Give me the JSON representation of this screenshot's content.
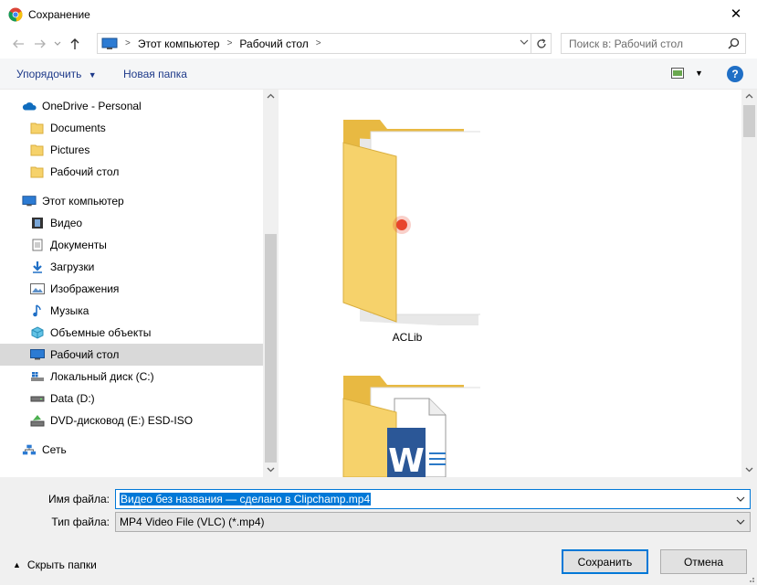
{
  "window": {
    "title": "Сохранение",
    "close_glyph": "✕",
    "app_icon": "chrome-icon"
  },
  "address_bar": {
    "crumbs": [
      "Этот компьютер",
      "Рабочий стол"
    ],
    "separator": ">"
  },
  "search": {
    "placeholder": "Поиск в: Рабочий стол"
  },
  "toolbar": {
    "organize_label": "Упорядочить",
    "new_folder_label": "Новая папка",
    "help_label": "?"
  },
  "nav_tree": {
    "onedrive": "OneDrive - Personal",
    "onedrive_children": [
      "Documents",
      "Pictures",
      "Рабочий стол"
    ],
    "this_pc": "Этот компьютер",
    "this_pc_children": [
      "Видео",
      "Документы",
      "Загрузки",
      "Изображения",
      "Музыка",
      "Объемные объекты",
      "Рабочий стол",
      "Локальный диск (C:)",
      "Data (D:)",
      "DVD-дисковод (E:) ESD-ISO"
    ],
    "network": "Сеть",
    "selected": "Рабочий стол"
  },
  "files": [
    {
      "name": "ACLib",
      "kind": "folder"
    },
    {
      "name": "",
      "kind": "folder-word"
    }
  ],
  "form": {
    "filename_label": "Имя файла:",
    "filename_value": "Видео без названия — сделано в Clipchamp.mp4",
    "filetype_label": "Тип файла:",
    "filetype_value": "MP4 Video File (VLC) (*.mp4)"
  },
  "footer": {
    "hide_folders_label": "Скрыть папки",
    "save_label": "Сохранить",
    "cancel_label": "Отмена"
  },
  "colors": {
    "accent": "#0078d7",
    "folder_yellow": "#f6d26b",
    "selected_bg": "#d9d9d9"
  }
}
